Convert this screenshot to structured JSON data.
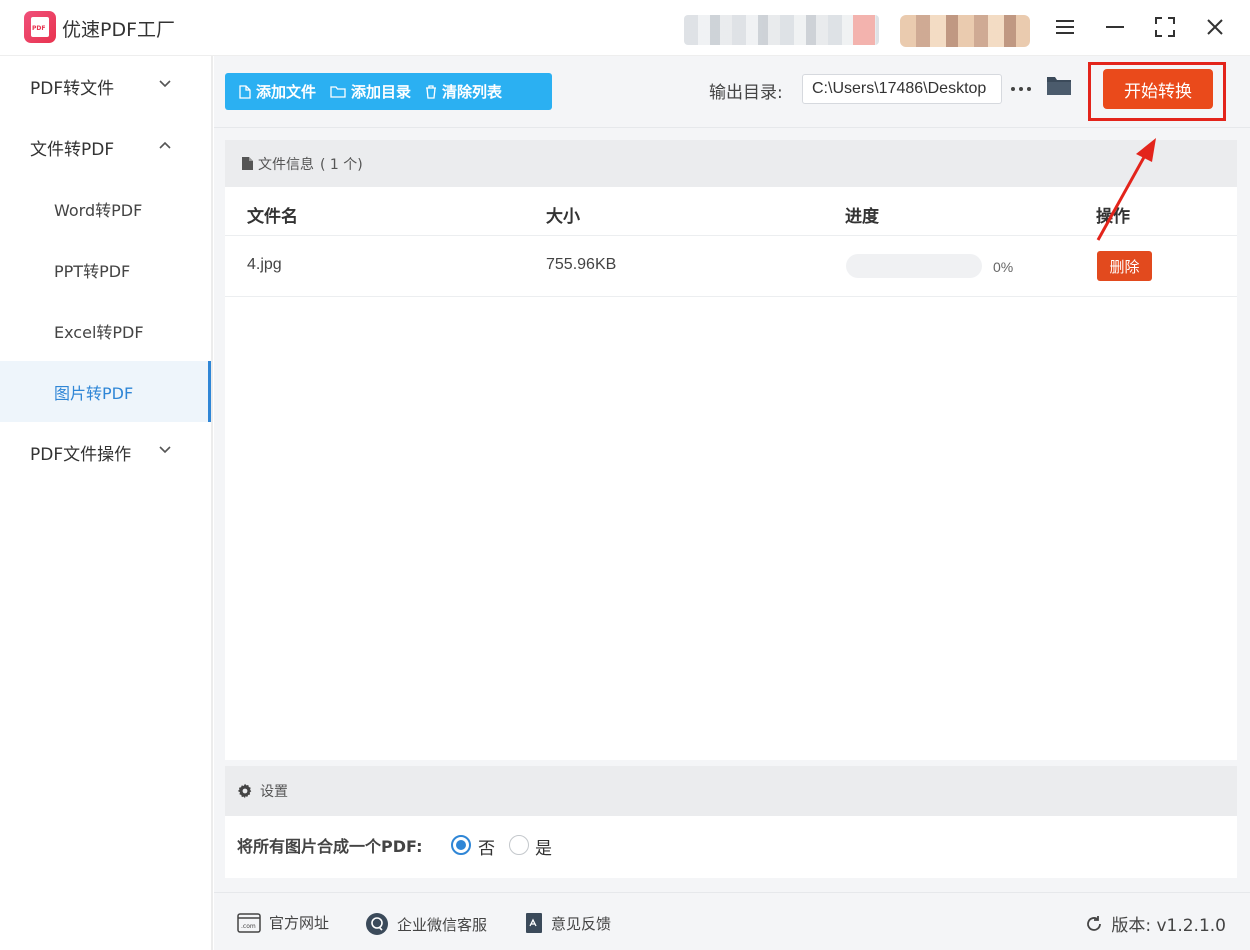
{
  "app": {
    "title": "优速PDF工厂",
    "logo_text": "PDF"
  },
  "window_controls": [
    "menu-icon",
    "minimize-icon",
    "maximize-icon",
    "close-icon"
  ],
  "sidebar": {
    "items": [
      {
        "label": "PDF转文件",
        "level": "top",
        "expanded": false
      },
      {
        "label": "文件转PDF",
        "level": "top",
        "expanded": true
      },
      {
        "label": "Word转PDF",
        "level": "sub"
      },
      {
        "label": "PPT转PDF",
        "level": "sub"
      },
      {
        "label": "Excel转PDF",
        "level": "sub"
      },
      {
        "label": "图片转PDF",
        "level": "sub",
        "active": true
      },
      {
        "label": "PDF文件操作",
        "level": "top",
        "expanded": false
      }
    ]
  },
  "toolbar": {
    "add_file": "添加文件",
    "add_folder": "添加目录",
    "clear_list": "清除列表",
    "output_label": "输出目录:",
    "output_path": "C:\\Users\\17486\\Desktop",
    "start_button": "开始转换"
  },
  "file_panel": {
    "title": "文件信息",
    "count": "( 1 个)",
    "columns": [
      "文件名",
      "大小",
      "进度",
      "操作"
    ],
    "rows": [
      {
        "name": "4.jpg",
        "size": "755.96KB",
        "progress_text": "0%",
        "progress": 0,
        "action": "删除"
      }
    ]
  },
  "settings": {
    "title": "设置",
    "merge_label": "将所有图片合成一个PDF:",
    "options": [
      {
        "label": "否",
        "checked": true
      },
      {
        "label": "是",
        "checked": false
      }
    ]
  },
  "footer": {
    "links": [
      "官方网址",
      "企业微信客服",
      "意见反馈"
    ],
    "version": "版本: v1.2.1.0"
  },
  "colors": {
    "accent_blue": "#2bb0f2",
    "active_blue": "#2f86d6",
    "start_orange": "#ea4a1b",
    "highlight_red": "#e3241b"
  }
}
